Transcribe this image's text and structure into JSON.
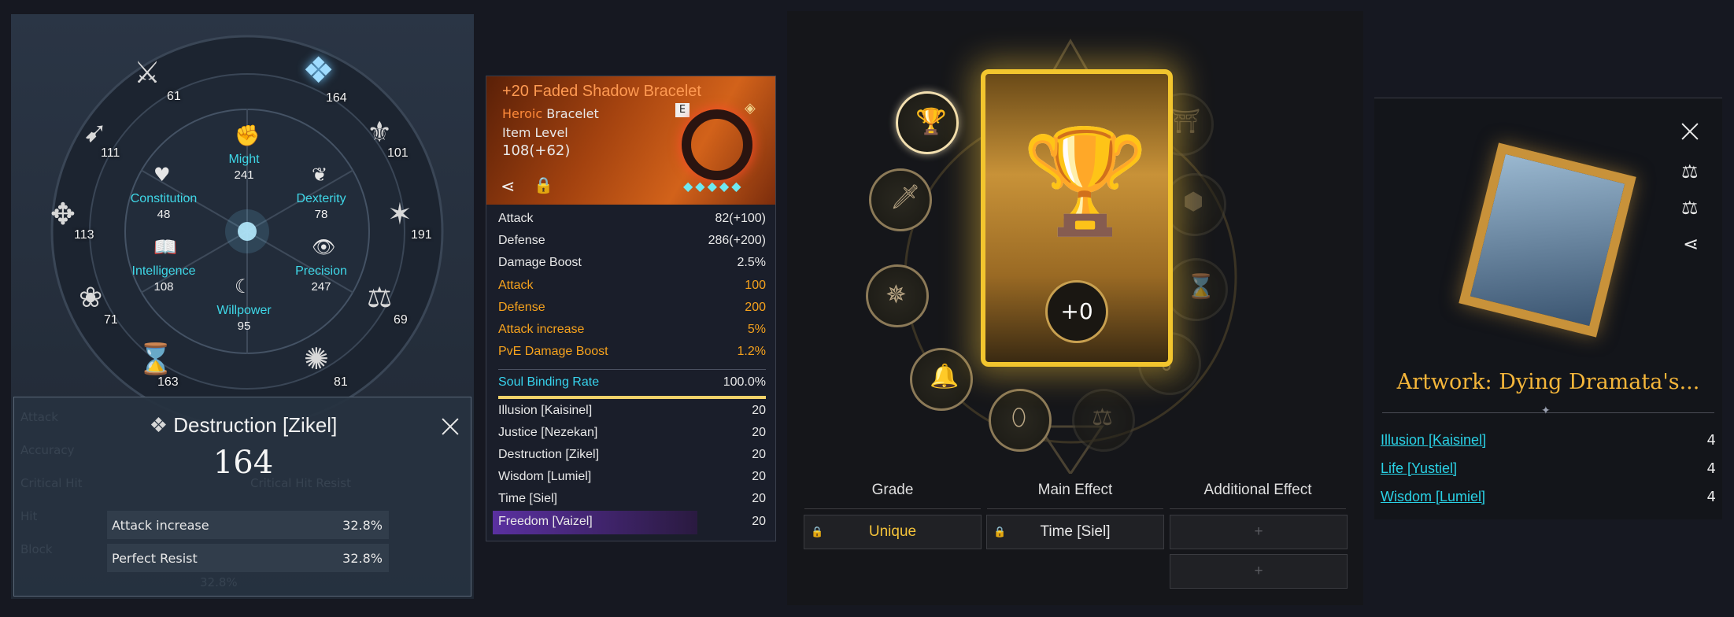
{
  "stat_panel": {
    "stats": {
      "might": {
        "label": "Might",
        "value": "241"
      },
      "constitution": {
        "label": "Constitution",
        "value": "48"
      },
      "dexterity": {
        "label": "Dexterity",
        "value": "78"
      },
      "intelligence": {
        "label": "Intelligence",
        "value": "108"
      },
      "precision": {
        "label": "Precision",
        "value": "247"
      },
      "willpower": {
        "label": "Willpower",
        "value": "95"
      }
    },
    "gods": [
      "61",
      "164",
      "111",
      "101",
      "113",
      "191",
      "71",
      "69",
      "163",
      "81"
    ],
    "detail": {
      "title": "Destruction [Zikel]",
      "value": "164",
      "rows": [
        {
          "label": "Attack increase",
          "value": "32.8%"
        },
        {
          "label": "Perfect Resist",
          "value": "32.8%"
        }
      ],
      "ghost_text": [
        "Attack",
        "Accuracy",
        "Critical Hit",
        "Hit",
        "Block",
        "Perfect Resist",
        "Critical Hit Resist",
        "32.8%"
      ]
    }
  },
  "tooltip": {
    "title": "+20 Faded Shadow Bracelet",
    "grade": "Heroic",
    "type": "Bracelet",
    "item_level_label": "Item Level",
    "item_level": "108(+62)",
    "tier_badge": "E",
    "base_stats": [
      {
        "label": "Attack",
        "value": "82(+100)"
      },
      {
        "label": "Defense",
        "value": "286(+200)"
      },
      {
        "label": "Damage Boost",
        "value": "2.5%"
      }
    ],
    "bonus_stats": [
      {
        "label": "Attack",
        "value": "100"
      },
      {
        "label": "Defense",
        "value": "200"
      },
      {
        "label": "Attack increase",
        "value": "5%"
      },
      {
        "label": "PvE Damage Boost",
        "value": "1.2%"
      }
    ],
    "soul_binding": {
      "label": "Soul Binding Rate",
      "value": "100.0%",
      "fraction": 1.0
    },
    "gods": [
      {
        "label": "Illusion [Kaisinel]",
        "value": "20"
      },
      {
        "label": "Justice [Nezekan]",
        "value": "20"
      },
      {
        "label": "Destruction [Zikel]",
        "value": "20"
      },
      {
        "label": "Wisdom [Lumiel]",
        "value": "20"
      },
      {
        "label": "Time [Siel]",
        "value": "20"
      },
      {
        "label": "Freedom [Vaizel]",
        "value": "20"
      }
    ],
    "colors": {
      "orange": "#f6a21d",
      "cyan": "#37d4ee",
      "title": "#ff9a52",
      "freedom_bg": "#4a2a7a"
    }
  },
  "card_panel": {
    "enhance": "+0",
    "headers": {
      "grade": "Grade",
      "main": "Main Effect",
      "additional": "Additional Effect"
    },
    "grade_value": "Unique",
    "main_value": "Time [Siel]",
    "add_slot_1": "+",
    "add_slot_2": "+",
    "colors": {
      "unique": "#f4c33a",
      "gold": "#f2c52e"
    }
  },
  "artwork_panel": {
    "title": "Artwork: Dying Dramata's...",
    "effects": [
      {
        "label": "Illusion [Kaisinel]",
        "value": "4"
      },
      {
        "label": "Life [Yustiel]",
        "value": "4"
      },
      {
        "label": "Wisdom [Lumiel]",
        "value": "4"
      }
    ]
  }
}
